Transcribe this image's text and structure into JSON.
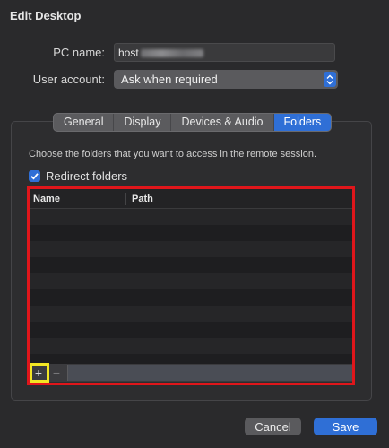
{
  "window": {
    "title": "Edit Desktop"
  },
  "form": {
    "pc_name_label": "PC name:",
    "pc_name_value": "host",
    "user_account_label": "User account:",
    "user_account_value": "Ask when required"
  },
  "tabs": [
    {
      "label": "General",
      "active": false
    },
    {
      "label": "Display",
      "active": false
    },
    {
      "label": "Devices & Audio",
      "active": false
    },
    {
      "label": "Folders",
      "active": true
    }
  ],
  "folders": {
    "description": "Choose the folders that you want to access in the remote session.",
    "redirect_label": "Redirect folders",
    "redirect_checked": true,
    "columns": [
      "Name",
      "Path"
    ],
    "rows": [],
    "add_label": "+",
    "remove_label": "−"
  },
  "buttons": {
    "cancel": "Cancel",
    "save": "Save"
  },
  "colors": {
    "accent": "#2f6fd6",
    "highlight_red": "#e0161b",
    "highlight_yellow": "#f3e624"
  },
  "icons": {
    "checkbox": "checkmark-icon",
    "stepper": "updown-chevron-icon",
    "add": "plus-icon",
    "remove": "minus-icon"
  }
}
